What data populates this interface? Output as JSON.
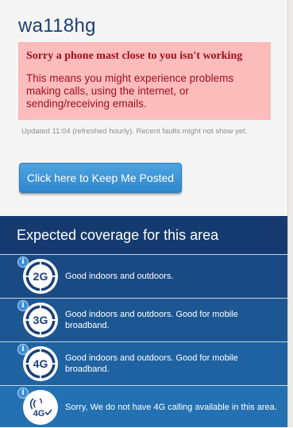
{
  "postcode": "wa118hg",
  "alert": {
    "title": "Sorry a phone mast close to you isn't working",
    "body": "This means you might experience problems making calls, using the internet, or sending/receiving emails."
  },
  "updated_text": "Updated 11:04 (refreshed hourly). Recent faults might not show yet.",
  "keep_posted_label": "Click here to Keep Me Posted",
  "coverage": {
    "title": "Expected coverage for this area",
    "info_glyph": "i",
    "rows": [
      {
        "badge": "2G",
        "icon": "2g-coverage-icon",
        "text": "Good indoors and outdoors."
      },
      {
        "badge": "3G",
        "icon": "3g-coverage-icon",
        "text": "Good indoors and outdoors. Good for mobile broadband."
      },
      {
        "badge": "4G",
        "icon": "4g-coverage-icon",
        "text": "Good indoors and outdoors. Good for mobile broadband."
      },
      {
        "badge": "4G",
        "icon": "4g-calling-icon",
        "text": "Sorry, We do not have 4G calling available in this area."
      }
    ]
  },
  "colors": {
    "heading": "#1d3f74",
    "alert_bg": "#fcbcbc",
    "alert_text": "#a0101a",
    "button": "#3a93d6",
    "coverage_bg": "#153a6f"
  }
}
